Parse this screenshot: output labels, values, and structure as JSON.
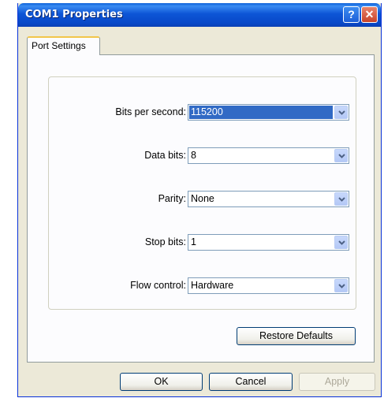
{
  "window": {
    "title": "COM1 Properties",
    "help_glyph": "?",
    "close_glyph": "✕"
  },
  "tab": {
    "label": "Port Settings"
  },
  "fields": {
    "bits_per_second": {
      "label": "Bits per second:",
      "value": "115200"
    },
    "data_bits": {
      "label": "Data bits:",
      "value": "8"
    },
    "parity": {
      "label": "Parity:",
      "value": "None"
    },
    "stop_bits": {
      "label": "Stop bits:",
      "value": "1"
    },
    "flow_control": {
      "label": "Flow control:",
      "value": "Hardware"
    }
  },
  "buttons": {
    "restore_defaults": "Restore Defaults",
    "ok": "OK",
    "cancel": "Cancel",
    "apply": "Apply"
  },
  "colors": {
    "titlebar": "#0a55d6",
    "window_bg": "#ece9d8",
    "selection": "#316ac5"
  }
}
